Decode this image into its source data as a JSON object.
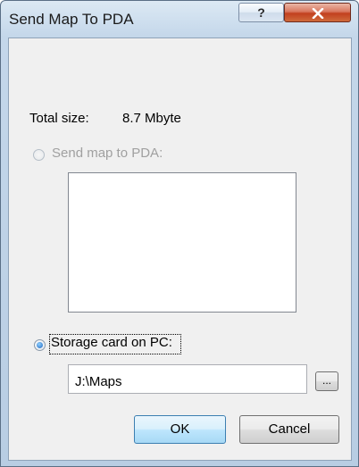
{
  "window": {
    "title": "Send Map To PDA",
    "help_label": "?",
    "close_label": "x"
  },
  "dialog": {
    "total_size_label": "Total size:",
    "total_size_value": "8.7 Mbyte",
    "send_to_pda_label": "Send map to PDA:",
    "storage_card_label": "Storage card on PC:",
    "path_value": "J:\\Maps",
    "browse_label": "...",
    "ok_label": "OK",
    "cancel_label": "Cancel"
  }
}
